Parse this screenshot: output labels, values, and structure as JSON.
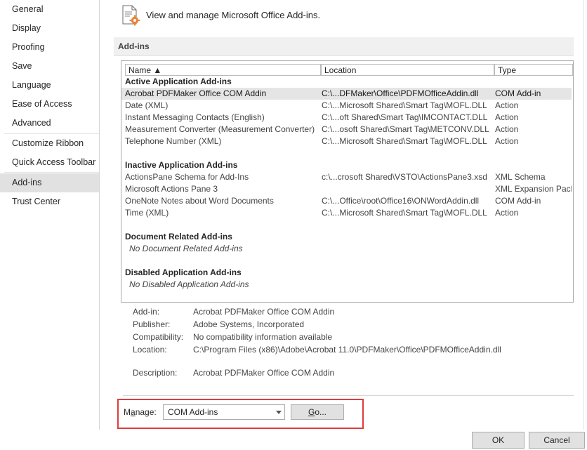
{
  "nav": {
    "items": [
      "General",
      "Display",
      "Proofing",
      "Save",
      "Language",
      "Ease of Access",
      "Advanced",
      "Customize Ribbon",
      "Quick Access Toolbar",
      "Add-ins",
      "Trust Center"
    ],
    "selected": "Add-ins"
  },
  "header": {
    "text": "View and manage Microsoft Office Add-ins.",
    "icon": "addins-document-gear-icon"
  },
  "section": {
    "title": "Add-ins"
  },
  "table": {
    "columns": {
      "name": "Name ▲",
      "location": "Location",
      "type": "Type"
    },
    "groups": {
      "active": {
        "title": "Active Application Add-ins",
        "rows": [
          {
            "name": "Acrobat PDFMaker Office COM Addin",
            "location": "C:\\...DFMaker\\Office\\PDFMOfficeAddin.dll",
            "type": "COM Add-in"
          },
          {
            "name": "Date (XML)",
            "location": "C:\\...Microsoft Shared\\Smart Tag\\MOFL.DLL",
            "type": "Action"
          },
          {
            "name": "Instant Messaging Contacts (English)",
            "location": "C:\\...oft Shared\\Smart Tag\\IMCONTACT.DLL",
            "type": "Action"
          },
          {
            "name": "Measurement Converter (Measurement Converter)",
            "location": "C:\\...osoft Shared\\Smart Tag\\METCONV.DLL",
            "type": "Action"
          },
          {
            "name": "Telephone Number (XML)",
            "location": "C:\\...Microsoft Shared\\Smart Tag\\MOFL.DLL",
            "type": "Action"
          }
        ]
      },
      "inactive": {
        "title": "Inactive Application Add-ins",
        "rows": [
          {
            "name": "ActionsPane Schema for Add-Ins",
            "location": "c:\\...crosoft Shared\\VSTO\\ActionsPane3.xsd",
            "type": "XML Schema"
          },
          {
            "name": "Microsoft Actions Pane 3",
            "location": "",
            "type": "XML Expansion Pack"
          },
          {
            "name": "OneNote Notes about Word Documents",
            "location": "C:\\...Office\\root\\Office16\\ONWordAddin.dll",
            "type": "COM Add-in"
          },
          {
            "name": "Time (XML)",
            "location": "C:\\...Microsoft Shared\\Smart Tag\\MOFL.DLL",
            "type": "Action"
          }
        ]
      },
      "document": {
        "title": "Document Related Add-ins",
        "empty": "No Document Related Add-ins"
      },
      "disabled": {
        "title": "Disabled Application Add-ins",
        "empty": "No Disabled Application Add-ins"
      }
    }
  },
  "details": {
    "addin_label": "Add-in:",
    "addin": "Acrobat PDFMaker Office COM Addin",
    "publisher_label": "Publisher:",
    "publisher": "Adobe Systems, Incorporated",
    "compat_label": "Compatibility:",
    "compat": "No compatibility information available",
    "location_label": "Location:",
    "location": "C:\\Program Files (x86)\\Adobe\\Acrobat 11.0\\PDFMaker\\Office\\PDFMOfficeAddin.dll",
    "description_label": "Description:",
    "description": "Acrobat PDFMaker Office COM Addin"
  },
  "manage": {
    "label_prefix": "M",
    "label_underlined": "a",
    "label_suffix": "nage:",
    "selected": "COM Add-ins",
    "go_underlined": "G",
    "go_suffix": "o...",
    "highlight_color": "#e03c3c"
  },
  "footer": {
    "ok": "OK",
    "cancel": "Cancel"
  }
}
